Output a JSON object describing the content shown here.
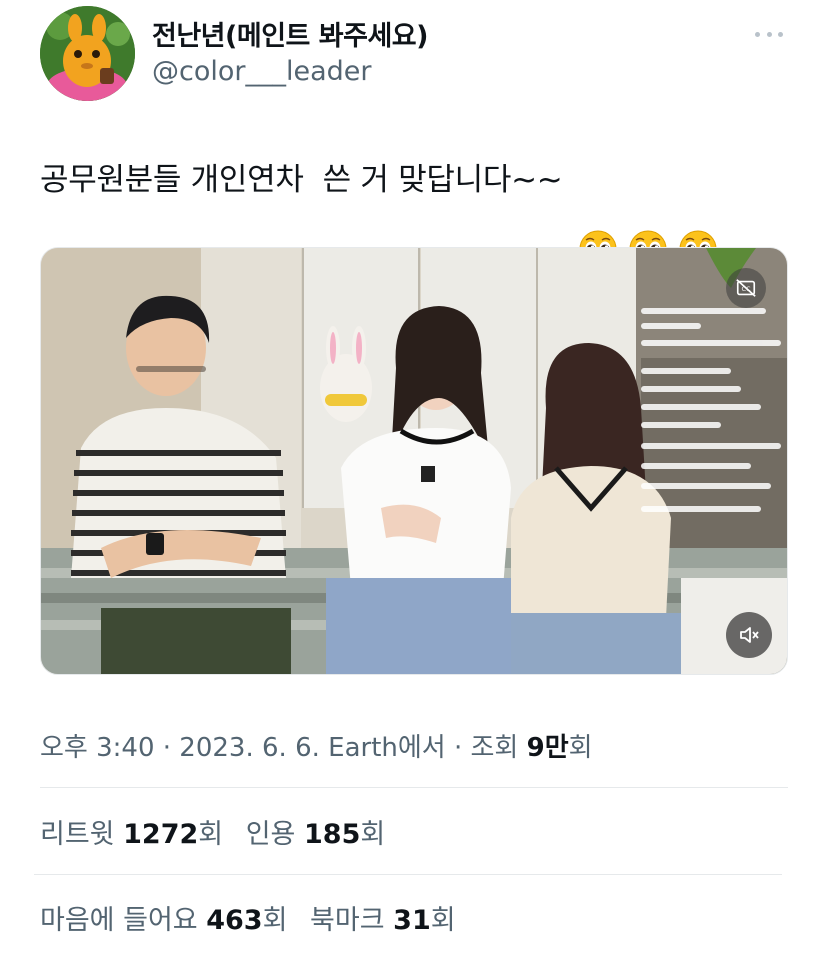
{
  "author": {
    "display_name": "전난년(메인트 봐주세요)",
    "handle": "@color___leader"
  },
  "tweet": {
    "text": "공무원분들 개인연차  쓴 거 맞답니다~~",
    "emojis": [
      "pleading-face",
      "pleading-face",
      "pleading-face"
    ]
  },
  "media": {
    "type": "video",
    "overlay_chat": [
      "반이죠",
      "SAYE..KVERBS  오 여긴 좀",
      "PE Hill  ㅋㅇㅇㅇ",
      "Hash...  미당...",
      "Love...  찐 미담 등장",
      "쉬다운  항상 무릎 ㅋㅋㅋㅋ",
      "일...  진짜 셋다 너무 멋져요",
      "Fine Ta...  이것 ㅋㅋ"
    ]
  },
  "meta": {
    "time": "오후 3:40",
    "date": "2023. 6. 6.",
    "source": "Earth에서",
    "views_label": "조회",
    "views_value": "9만",
    "views_unit": "회"
  },
  "stats": {
    "retweets_label": "리트윗",
    "retweets_value": "1272",
    "retweets_unit": "회",
    "quotes_label": "인용",
    "quotes_value": "185",
    "quotes_unit": "회",
    "likes_label": "마음에 들어요",
    "likes_value": "463",
    "likes_unit": "회",
    "bookmarks_label": "북마크",
    "bookmarks_value": "31",
    "bookmarks_unit": "회"
  },
  "colors": {
    "text_primary": "#0f1419",
    "text_secondary": "#536471",
    "divider": "#e6e9eb"
  }
}
